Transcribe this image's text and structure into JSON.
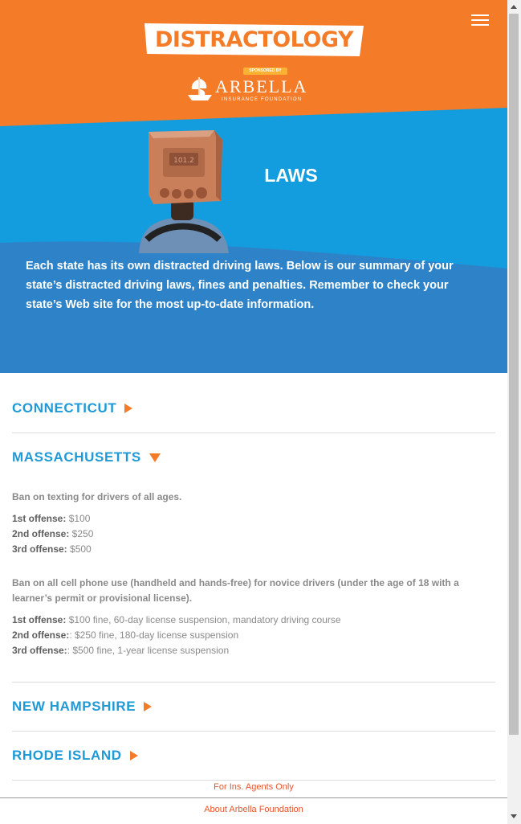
{
  "header": {
    "logo_text": "DISTRACTOLOGY",
    "sponsored_by": "SPONSORED BY",
    "sponsor_name": "ARBELLA",
    "sponsor_sub": "INSURANCE FOUNDATION",
    "menu_icon": "hamburger-menu-icon"
  },
  "hero": {
    "title": "LAWS",
    "intro": "Each state has its own distracted driving laws. Below is our summary of your state’s distracted driving laws, fines and penalties. Remember to check your state’s Web site for the most up-to-date information."
  },
  "states": [
    {
      "name": "CONNECTICUT",
      "expanded": false
    },
    {
      "name": "MASSACHUSETTS",
      "expanded": true,
      "laws": [
        {
          "description": "Ban on texting for drivers of all ages.",
          "offenses": [
            {
              "label": "1st offense:",
              "penalty": " $100"
            },
            {
              "label": "2nd offense:",
              "penalty": " $250"
            },
            {
              "label": "3rd offense:",
              "penalty": " $500"
            }
          ]
        },
        {
          "description": "Ban on all cell phone use (handheld and hands-free) for novice drivers (under the age of 18 with a learner’s permit or provisional license).",
          "offenses": [
            {
              "label": "1st offense:",
              "penalty": " $100 fine, 60-day license suspension, mandatory driving course"
            },
            {
              "label": "2nd offense:",
              "penalty": ": $250 fine, 180-day license suspension"
            },
            {
              "label": "3rd offense:",
              "penalty": ": $500 fine, 1-year license suspension"
            }
          ]
        }
      ]
    },
    {
      "name": "NEW HAMPSHIRE",
      "expanded": false
    },
    {
      "name": "RHODE ISLAND",
      "expanded": false
    }
  ],
  "footer": {
    "agents_link": "For Ins. Agents Only",
    "about_link": "About Arbella Foundation"
  },
  "colors": {
    "orange": "#f47b27",
    "blue": "#1f9ad7",
    "text_gray": "#8a8a8a"
  }
}
